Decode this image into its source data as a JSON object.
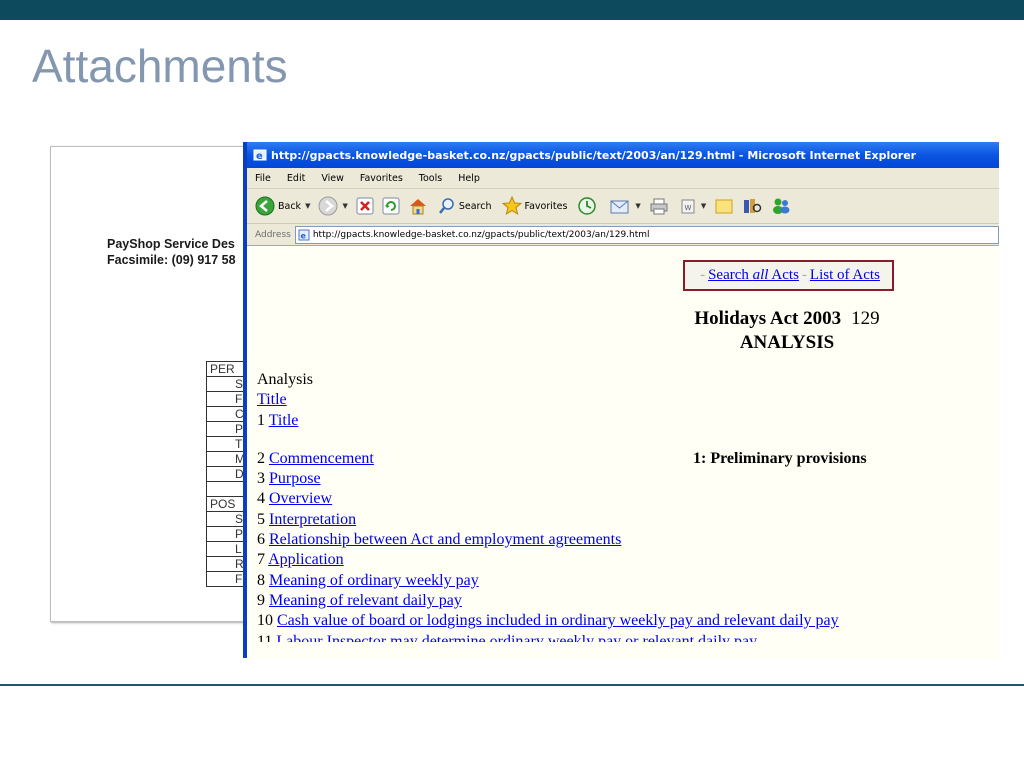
{
  "slide": {
    "title": "Attachments"
  },
  "fax_doc": {
    "line1": "PayShop Service Des",
    "line2": "Facsimile: (09) 917 58",
    "rows": [
      {
        "text": "PER",
        "indent": false
      },
      {
        "text": "S",
        "indent": true
      },
      {
        "text": "F",
        "indent": true
      },
      {
        "text": "C",
        "indent": true
      },
      {
        "text": "P",
        "indent": true
      },
      {
        "text": "T",
        "indent": true
      },
      {
        "text": "M",
        "indent": true
      },
      {
        "text": "D",
        "indent": true
      },
      {
        "text": "",
        "indent": true
      },
      {
        "text": "POS",
        "indent": false
      },
      {
        "text": "S",
        "indent": true
      },
      {
        "text": "P",
        "indent": true
      },
      {
        "text": "L",
        "indent": true
      },
      {
        "text": "R",
        "indent": true
      },
      {
        "text": "F",
        "indent": true
      }
    ]
  },
  "browser": {
    "title": "http://gpacts.knowledge-basket.co.nz/gpacts/public/text/2003/an/129.html - Microsoft Internet Explorer",
    "menu": [
      "File",
      "Edit",
      "View",
      "Favorites",
      "Tools",
      "Help"
    ],
    "toolbar": {
      "back_label": "Back",
      "search_label": "Search",
      "favorites_label": "Favorites"
    },
    "address_label": "Address",
    "address_value": "http://gpacts.knowledge-basket.co.nz/gpacts/public/text/2003/an/129.html"
  },
  "page": {
    "nav": {
      "sep": "-",
      "search_prefix": "Search ",
      "search_em": "all",
      "search_suffix": " Acts",
      "list_acts": "List of Acts"
    },
    "act_title": "Holidays Act 2003",
    "act_number": "129",
    "analysis_heading": "ANALYSIS",
    "analysis_label": "Analysis",
    "title_link": "Title",
    "item1": {
      "num": "1",
      "label": "Title"
    },
    "part_heading": "1: Preliminary provisions",
    "items": [
      {
        "num": "2",
        "label": "Commencement"
      },
      {
        "num": "3",
        "label": "Purpose"
      },
      {
        "num": "4",
        "label": "Overview"
      },
      {
        "num": "5",
        "label": "Interpretation"
      },
      {
        "num": "6",
        "label": "Relationship between Act and employment agreements"
      },
      {
        "num": "7",
        "label": "Application"
      },
      {
        "num": "8",
        "label": "Meaning of ordinary weekly pay"
      },
      {
        "num": "9",
        "label": "Meaning of relevant daily pay"
      },
      {
        "num": "10",
        "label": "Cash value of board or lodgings included in ordinary weekly pay and relevant daily pay"
      }
    ],
    "cut_item": {
      "num": "11",
      "label": "Labour Inspector may determine ordinary weekly pay or relevant daily pay"
    }
  },
  "colors": {
    "top_bar": "#0d4a5e",
    "title": "#8497b0",
    "link": "#0000ee",
    "nav_border": "#8b1a2b",
    "xp_blue": "#0a55e0"
  }
}
